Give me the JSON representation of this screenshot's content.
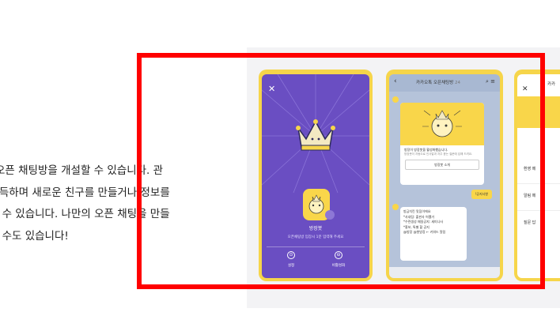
{
  "article": {
    "lines": [
      "오픈 채팅방을 개설할 수 있습니다. 관",
      "-득하며 새로운 친구를 만들거나 정보를",
      "· 수 있습니다. 나만의 오픈 채팅을 만들",
      "· 수도 있습니다!"
    ]
  },
  "phone1": {
    "close_icon": "✕",
    "profile_name": "방장봇",
    "profile_desc": "오픈채팅방 입장시 1분 입력해 주세요",
    "buttons": [
      "설정",
      "비활성화"
    ],
    "button_glyphs": [
      "⊙",
      "⊖"
    ]
  },
  "phone2": {
    "title": "카카오톡 오픈채팅방",
    "title_count": "24",
    "card_text": "방장이 방장봇을 활성화했습니다.",
    "card_sub": "방장봇이 자동으로 인사말과 자주 묻는 질문에 답해 드려요.",
    "card_button": "방장봇 소개",
    "yellow_bubble": "!공지사항",
    "msg_lines": [
      "방금치킨 맛집이에요",
      "*사내팀: 출판사 어쨌거",
      "*수련생성 매일공지: 세미나사",
      "*홍보, 특별 할 공지",
      "@방장 @봇방장 ← 키워드 알림"
    ]
  },
  "phone3": {
    "close_icon": "✕",
    "title": "카카",
    "rows": [
      "환영 메",
      "알림 메",
      "질문 답"
    ]
  },
  "colors": {
    "highlight": "#ff0000",
    "purple": "#6a4ec2",
    "yellow": "#f9d64a"
  }
}
